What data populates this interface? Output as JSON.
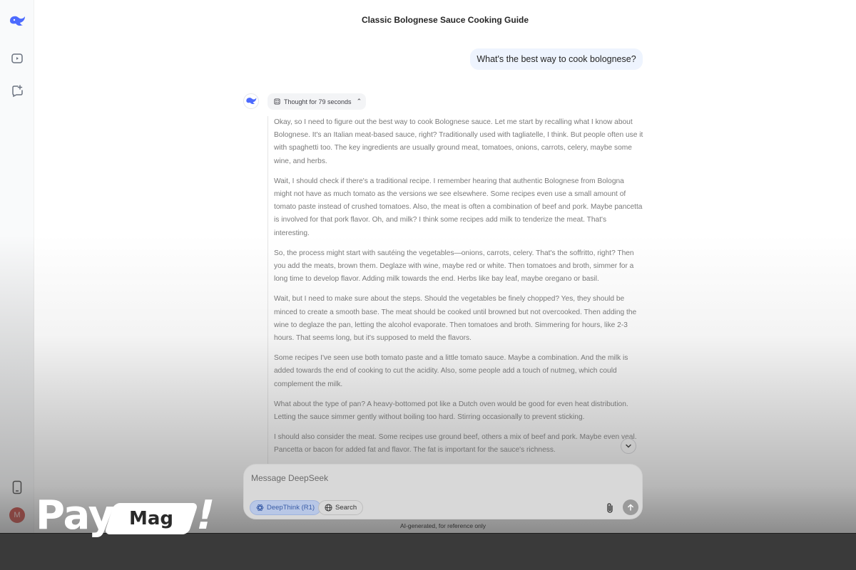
{
  "app": {
    "name": "DeepSeek",
    "accent_color": "#4d6bfe"
  },
  "sidebar": {
    "items": [
      {
        "icon": "deepseek-logo-icon"
      },
      {
        "icon": "sidebar-toggle-icon"
      },
      {
        "icon": "new-chat-icon"
      }
    ],
    "bottom": [
      {
        "icon": "mobile-app-icon"
      },
      {
        "avatar_initial": "M"
      }
    ]
  },
  "chat": {
    "title": "Classic Bolognese Sauce Cooking Guide",
    "user_message": "What's the best way to cook bolognese?",
    "thought_label": "Thought for 79 seconds",
    "thinking_paragraphs": [
      "Okay, so I need to figure out the best way to cook Bolognese sauce. Let me start by recalling what I know about Bolognese. It's an Italian meat-based sauce, right? Traditionally used with tagliatelle, I think. But people often use it with spaghetti too. The key ingredients are usually ground meat, tomatoes, onions, carrots, celery, maybe some wine, and herbs.",
      "Wait, I should check if there's a traditional recipe. I remember hearing that authentic Bolognese from Bologna might not have as much tomato as the versions we see elsewhere. Some recipes even use a small amount of tomato paste instead of crushed tomatoes. Also, the meat is often a combination of beef and pork. Maybe pancetta is involved for that pork flavor. Oh, and milk? I think some recipes add milk to tenderize the meat. That's interesting.",
      "So, the process might start with sautéing the vegetables—onions, carrots, celery. That's the soffritto, right? Then you add the meats, brown them. Deglaze with wine, maybe red or white. Then tomatoes and broth, simmer for a long time to develop flavor. Adding milk towards the end. Herbs like bay leaf, maybe oregano or basil.",
      "Wait, but I need to make sure about the steps. Should the vegetables be finely chopped? Yes, they should be minced to create a smooth base. The meat should be cooked until browned but not overcooked. Then adding the wine to deglaze the pan, letting the alcohol evaporate. Then tomatoes and broth. Simmering for hours, like 2-3 hours. That seems long, but it's supposed to meld the flavors.",
      "Some recipes I've seen use both tomato paste and a little tomato sauce. Maybe a combination. And the milk is added towards the end of cooking to cut the acidity. Also, some people add a touch of nutmeg, which could complement the milk.",
      "What about the type of pan? A heavy-bottomed pot like a Dutch oven would be good for even heat distribution. Letting the sauce simmer gently without boiling too hard. Stirring occasionally to prevent sticking.",
      "I should also consider the meat. Some recipes use ground beef, others a mix of beef and pork. Maybe even veal. Pancetta or bacon for added fat and flavor. The fat is important for the sauce's richness."
    ]
  },
  "composer": {
    "placeholder": "Message DeepSeek",
    "deepthink_label": "DeepThink (R1)",
    "search_label": "Search"
  },
  "footer": {
    "disclaimer": "AI-generated, for reference only"
  },
  "watermark": {
    "part1": "Pay",
    "part2": "Mag",
    "part3": "!"
  }
}
